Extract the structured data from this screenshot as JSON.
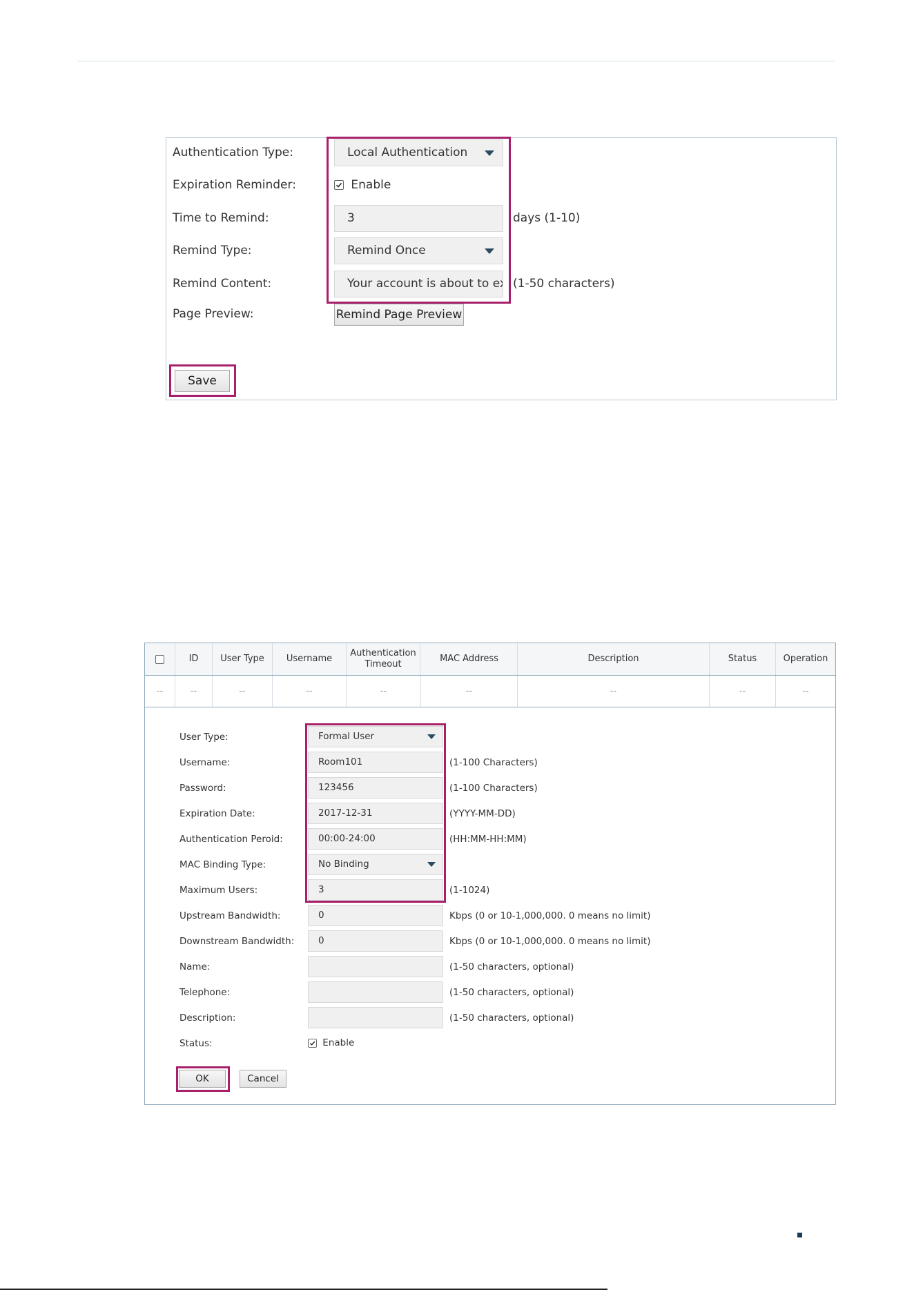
{
  "auth_form": {
    "authentication_type": {
      "label": "Authentication Type:",
      "value": "Local Authentication"
    },
    "expiration_reminder": {
      "label": "Expiration Reminder:",
      "checkbox_label": "Enable",
      "checked": true
    },
    "time_to_remind": {
      "label": "Time to Remind:",
      "value": "3",
      "hint": "days (1-10)"
    },
    "remind_type": {
      "label": "Remind Type:",
      "value": "Remind Once"
    },
    "remind_content": {
      "label": "Remind Content:",
      "value": "Your account is about to ex",
      "hint": "(1-50 characters)"
    },
    "page_preview": {
      "label": "Page Preview:",
      "button": "Remind Page Preview"
    },
    "save_button": "Save"
  },
  "user_table": {
    "columns": [
      "ID",
      "User Type",
      "Username",
      "Authentication Timeout",
      "MAC Address",
      "Description",
      "Status",
      "Operation"
    ],
    "row": [
      "--",
      "--",
      "--",
      "--",
      "--",
      "--",
      "--",
      "--",
      "--"
    ]
  },
  "user_form": {
    "user_type": {
      "label": "User Type:",
      "value": "Formal User"
    },
    "username": {
      "label": "Username:",
      "value": "Room101",
      "hint": "(1-100 Characters)"
    },
    "password": {
      "label": "Password:",
      "value": "123456",
      "hint": "(1-100 Characters)"
    },
    "expiration_date": {
      "label": "Expiration Date:",
      "value": "2017-12-31",
      "hint": "(YYYY-MM-DD)"
    },
    "auth_period": {
      "label": "Authentication Peroid:",
      "value": "00:00-24:00",
      "hint": "(HH:MM-HH:MM)"
    },
    "mac_binding_type": {
      "label": "MAC Binding Type:",
      "value": "No Binding"
    },
    "maximum_users": {
      "label": "Maximum Users:",
      "value": "3",
      "hint": "(1-1024)"
    },
    "upstream_bandwidth": {
      "label": "Upstream Bandwidth:",
      "value": "0",
      "hint": "Kbps (0 or 10-1,000,000. 0 means no limit)"
    },
    "downstream_bandwidth": {
      "label": "Downstream Bandwidth:",
      "value": "0",
      "hint": "Kbps (0 or 10-1,000,000. 0 means no limit)"
    },
    "name": {
      "label": "Name:",
      "value": "",
      "hint": "(1-50 characters, optional)"
    },
    "telephone": {
      "label": "Telephone:",
      "value": "",
      "hint": "(1-50 characters, optional)"
    },
    "description": {
      "label": "Description:",
      "value": "",
      "hint": "(1-50 characters, optional)"
    },
    "status": {
      "label": "Status:",
      "checkbox_label": "Enable",
      "checked": true
    },
    "ok_button": "OK",
    "cancel_button": "Cancel"
  },
  "colors": {
    "highlight": "#a8206b",
    "arrow": "#2b4a5e",
    "field_bg": "#f0f0f0"
  }
}
